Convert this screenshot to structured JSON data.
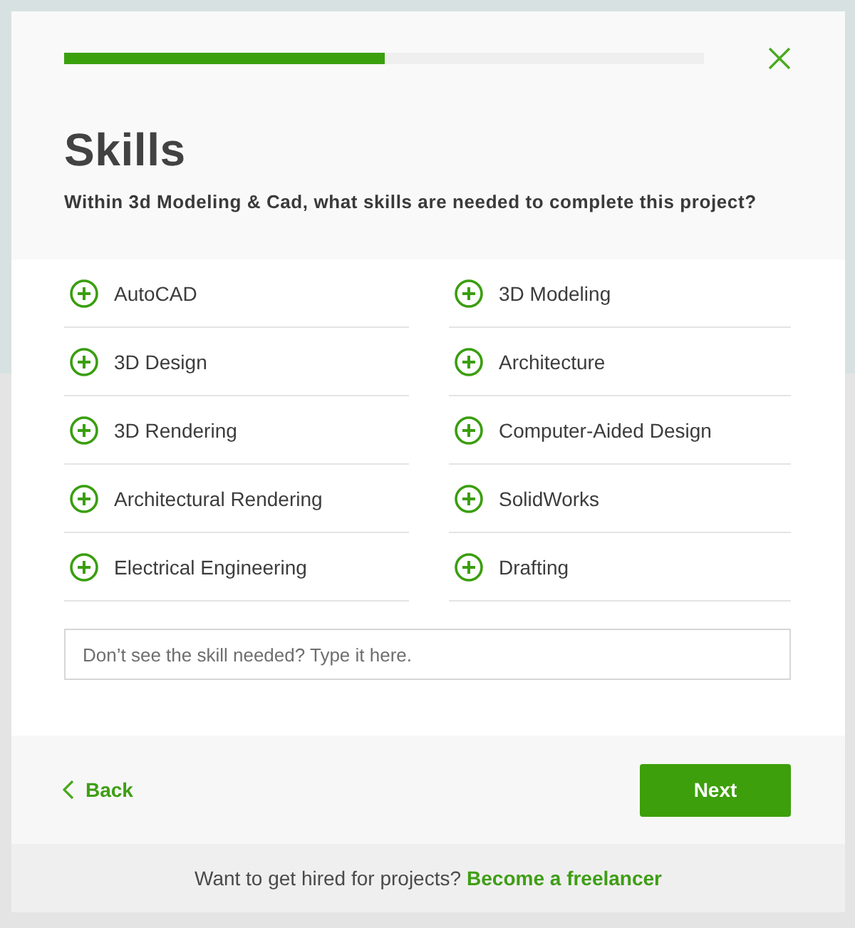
{
  "progress": {
    "level": 0.5
  },
  "title": "Skills",
  "subtitle": "Within 3d Modeling & Cad, what skills are needed to complete this project?",
  "skills": [
    {
      "label": "AutoCAD",
      "selected": false
    },
    {
      "label": "3D Modeling",
      "selected": false
    },
    {
      "label": "3D Design",
      "selected": false
    },
    {
      "label": "Architecture",
      "selected": false
    },
    {
      "label": "3D Rendering",
      "selected": false
    },
    {
      "label": "Computer-Aided Design",
      "selected": false
    },
    {
      "label": "Architectural Rendering",
      "selected": false
    },
    {
      "label": "SolidWorks",
      "selected": false
    },
    {
      "label": "Electrical Engineering",
      "selected": false
    },
    {
      "label": "Drafting",
      "selected": false
    }
  ],
  "custom_skill": {
    "placeholder": "Don’t see the skill needed? Type it here."
  },
  "back_button": {
    "label": "Back"
  },
  "next_button": {
    "label": "Next"
  },
  "footer": {
    "text": "Want to get hired for projects?",
    "link": "Become a freelancer"
  }
}
